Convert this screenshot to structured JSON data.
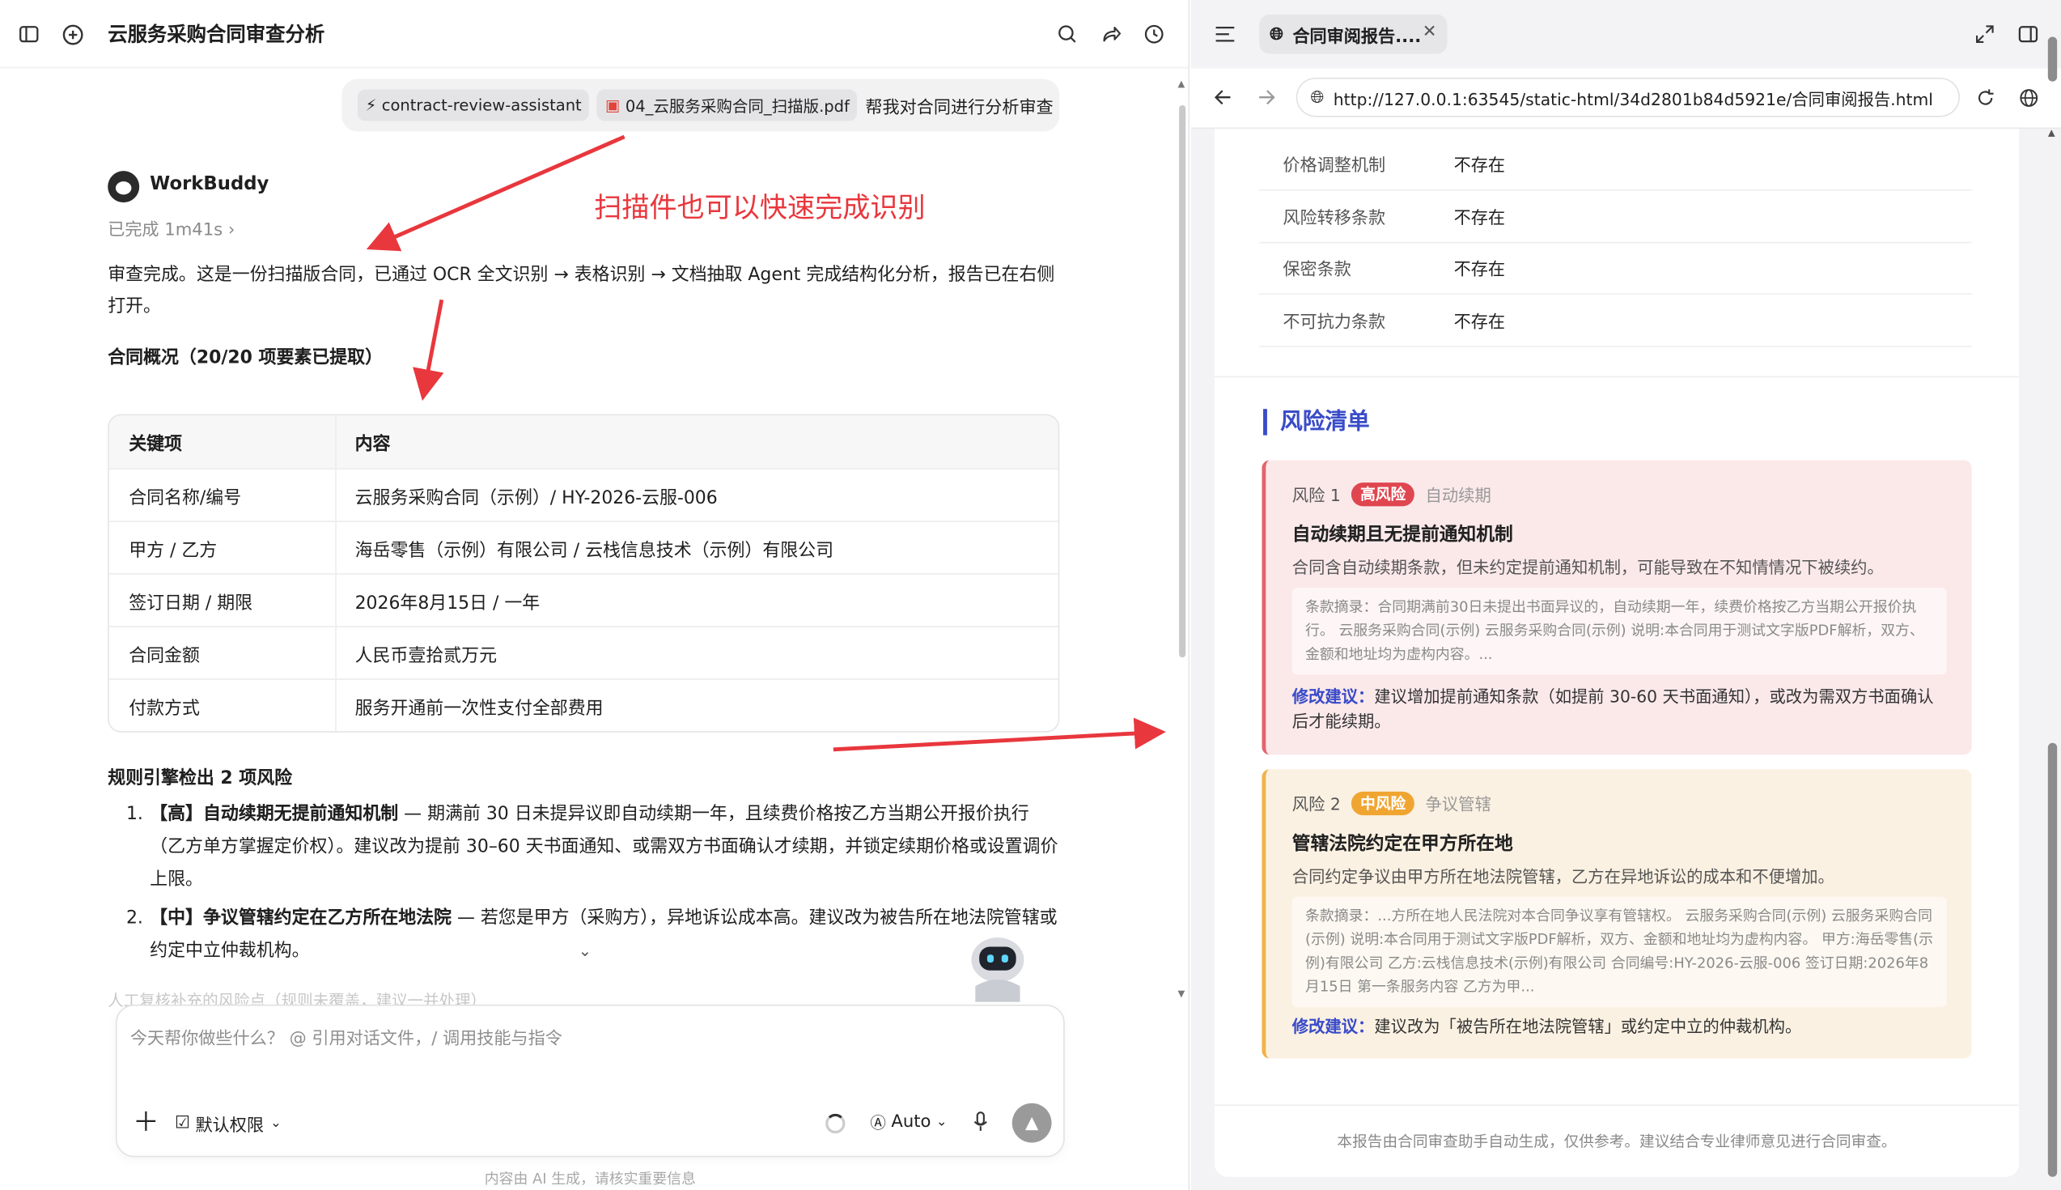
{
  "left": {
    "conversation_title": "云服务采购合同审查分析",
    "user_message": {
      "skill_chip": "contract-review-assistant",
      "file_chip": "04_云服务采购合同_扫描版.pdf",
      "text": "帮我对合同进行分析审查"
    },
    "agent": {
      "name": "WorkBuddy",
      "status": "已完成 1m41s"
    },
    "annotation": "扫描件也可以快速完成识别",
    "summary": "审查完成。这是一份扫描版合同，已通过 OCR 全文识别 → 表格识别 → 文档抽取 Agent 完成结构化分析，报告已在右侧打开。",
    "overview_title": "合同概况（20/20 项要素已提取）",
    "overview_table": {
      "headers": [
        "关键项",
        "内容"
      ],
      "rows": [
        [
          "合同名称/编号",
          "云服务采购合同（示例）/ HY-2026-云服-006"
        ],
        [
          "甲方 / 乙方",
          "海岳零售（示例）有限公司 / 云栈信息技术（示例）有限公司"
        ],
        [
          "签订日期 / 期限",
          "2026年8月15日 / 一年"
        ],
        [
          "合同金额",
          "人民币壹拾贰万元"
        ],
        [
          "付款方式",
          "服务开通前一次性支付全部费用"
        ]
      ]
    },
    "rules_title": "规则引擎检出 2 项风险",
    "risks": [
      {
        "num": "1.",
        "head": "【高】自动续期无提前通知机制",
        "body": " — 期满前 30 日未提异议即自动续期一年，且续费价格按乙方当期公开报价执行（乙方单方掌握定价权）。建议改为提前 30–60 天书面通知、或需双方书面确认才续期，并锁定续期价格或设置调价上限。"
      },
      {
        "num": "2.",
        "head": "【中】争议管辖约定在乙方所在地法院",
        "body": " — 若您是甲方（采购方），异地诉讼成本高。建议改为被告所在地法院管辖或约定中立仲裁机构。"
      }
    ],
    "cut_text": "人工复核补充的风险点（规则未覆盖，建议一并处理）",
    "composer": {
      "placeholder": "今天帮你做些什么？ @ 引用对话文件，/ 调用技能与指令",
      "permission": "默认权限",
      "model": "Auto"
    },
    "disclaimer": "内容由 AI 生成，请核实重要信息"
  },
  "browser": {
    "tab_title": "合同审阅报告....",
    "url": "http://127.0.0.1:63545/static-html/34d2801b84d5921e/合同审阅报告.html"
  },
  "report": {
    "clauses": [
      {
        "name": "价格调整机制",
        "value": "不存在"
      },
      {
        "name": "风险转移条款",
        "value": "不存在"
      },
      {
        "name": "保密条款",
        "value": "不存在"
      },
      {
        "name": "不可抗力条款",
        "value": "不存在"
      }
    ],
    "risk_section_title": "风险清单",
    "risk_cards": [
      {
        "label": "风险 1",
        "level": "高风险",
        "level_color": "#e04650",
        "category": "自动续期",
        "title": "自动续期且无提前通知机制",
        "desc": "合同含自动续期条款，但未约定提前通知机制，可能导致在不知情情况下被续约。",
        "excerpt_label": "条款摘录：",
        "excerpt": "合同期满前30日未提出书面异议的，自动续期一年，续费价格按乙方当期公开报价执行。 云服务采购合同(示例) 云服务采购合同(示例) 说明:本合同用于测试文字版PDF解析，双方、金额和地址均为虚构内容。...",
        "suggestion_label": "修改建议：",
        "suggestion": "建议增加提前通知条款（如提前 30-60 天书面通知），或改为需双方书面确认后才能续期。"
      },
      {
        "label": "风险 2",
        "level": "中风险",
        "level_color": "#f0a531",
        "category": "争议管辖",
        "title": "管辖法院约定在甲方所在地",
        "desc": "合同约定争议由甲方所在地法院管辖，乙方在异地诉讼的成本和不便增加。",
        "excerpt_label": "条款摘录：",
        "excerpt": "...方所在地人民法院对本合同争议享有管辖权。 云服务采购合同(示例) 云服务采购合同(示例) 说明:本合同用于测试文字版PDF解析，双方、金额和地址均为虚构内容。 甲方:海岳零售(示例)有限公司 乙方:云栈信息技术(示例)有限公司 合同编号:HY-2026-云服-006 签订日期:2026年8月15日 第一条服务内容 乙方为甲...",
        "suggestion_label": "修改建议：",
        "suggestion": "建议改为「被告所在地法院管辖」或约定中立的仲裁机构。"
      }
    ],
    "footer": "本报告由合同审查助手自动生成，仅供参考。建议结合专业律师意见进行合同审查。"
  },
  "colors": {
    "accent_blue": "#3a4cc9",
    "annotation_red": "#e8373d",
    "high_risk_bg": "#fbe9ea",
    "mid_risk_bg": "#fbf1e2"
  }
}
